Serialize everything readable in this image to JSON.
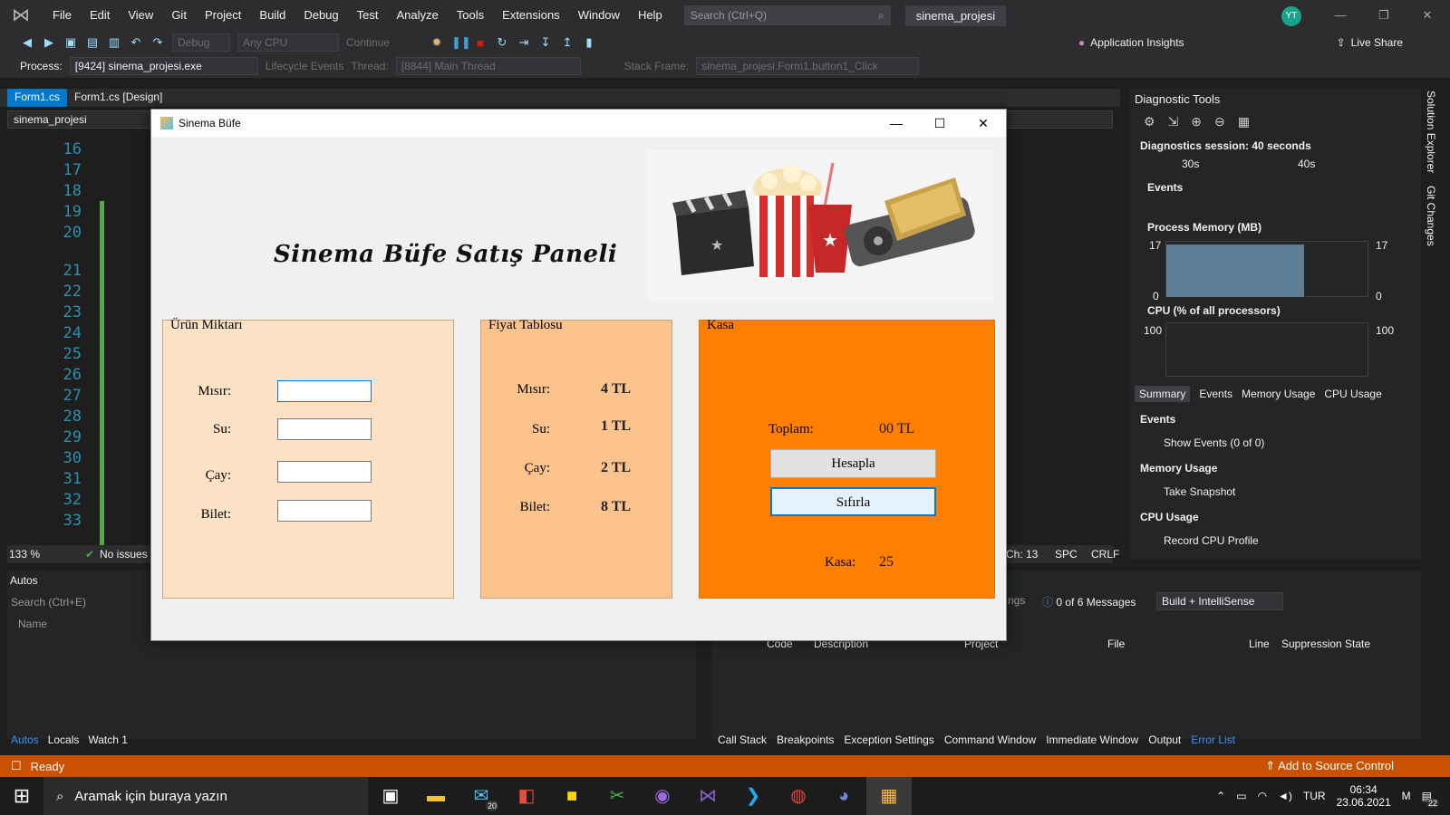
{
  "menu": [
    "File",
    "Edit",
    "View",
    "Git",
    "Project",
    "Build",
    "Debug",
    "Test",
    "Analyze",
    "Tools",
    "Extensions",
    "Window",
    "Help"
  ],
  "search": {
    "placeholder": "Search (Ctrl+Q)"
  },
  "solution_name": "sinema_projesi",
  "user_initials": "YT",
  "toolbar": {
    "config": "Debug",
    "platform": "Any CPU",
    "continue": "Continue",
    "app_insights": "Application Insights",
    "live_share": "Live Share"
  },
  "debug_bar": {
    "process_label": "Process:",
    "process": "[9424] sinema_projesi.exe",
    "lifecycle": "Lifecycle Events",
    "thread_label": "Thread:",
    "thread": "[8844] Main Thread",
    "stack_label": "Stack Frame:",
    "stack": "sinema_projesi.Form1.button1_Click"
  },
  "doc_tabs": [
    "Form1.cs",
    "Form1.cs [Design]"
  ],
  "nav_bar": "sinema_projesi",
  "editor": {
    "line_numbers": [
      "16",
      "17",
      "18",
      "19",
      "20",
      "21",
      "22",
      "23",
      "24",
      "25",
      "26",
      "27",
      "28",
      "29",
      "30",
      "31",
      "32",
      "33"
    ],
    "zoom": "133 %",
    "issues": "No issues f",
    "col": "Ch: 13",
    "spacing": "SPC",
    "eol": "CRLF"
  },
  "diagnostics": {
    "title": "Diagnostic Tools",
    "session": "Diagnostics session: 40 seconds",
    "timeline": [
      "30s",
      "40s"
    ],
    "events_header": "Events",
    "memory_header": "Process Memory (MB)",
    "memory_max": "17",
    "memory_min": "0",
    "cpu_header": "CPU (% of all processors)",
    "cpu_max": "100",
    "tabs": [
      "Summary",
      "Events",
      "Memory Usage",
      "CPU Usage"
    ],
    "sections": [
      {
        "title": "Events",
        "action": "Show Events (0 of 0)"
      },
      {
        "title": "Memory Usage",
        "action": "Take Snapshot"
      },
      {
        "title": "CPU Usage",
        "action": "Record CPU Profile"
      }
    ]
  },
  "side_tabs": [
    "Solution Explorer",
    "Git Changes"
  ],
  "autos": {
    "title": "Autos",
    "search": "Search (Ctrl+E)",
    "col": "Name",
    "tabs": [
      "Autos",
      "Locals",
      "Watch 1"
    ]
  },
  "errors": {
    "messages": "0 of 6 Messages",
    "build": "Build + IntelliSense",
    "partial": "ngs",
    "columns": [
      "Code",
      "Description",
      "Project",
      "File",
      "Line",
      "Suppression State"
    ],
    "tabs": [
      "Call Stack",
      "Breakpoints",
      "Exception Settings",
      "Command Window",
      "Immediate Window",
      "Output",
      "Error List"
    ]
  },
  "status": {
    "text": "Ready",
    "source_control": "Add to Source Control"
  },
  "taskbar": {
    "search": "Aramak için buraya yazın",
    "mail_badge": "20",
    "lang": "TUR",
    "time": "06:34",
    "date": "23.06.2021",
    "notif": "22"
  },
  "form": {
    "title": "Sinema Büfe",
    "heading": "Sinema  Büfe Satış Paneli",
    "group_quantity": {
      "title": "Ürün Miktarı",
      "labels": [
        "Mısır:",
        "Su:",
        "Çay:",
        "Bilet:"
      ]
    },
    "group_prices": {
      "title": "Fiyat Tablosu",
      "labels": [
        "Mısır:",
        "Su:",
        "Çay:",
        "Bilet:"
      ],
      "prices": [
        "4 TL",
        "1 TL",
        "2 TL",
        "8 TL"
      ]
    },
    "group_kasa": {
      "title": "Kasa",
      "total_label": "Toplam:",
      "total_value": "00 TL",
      "calc_button": "Hesapla",
      "reset_button": "Sıfırla",
      "kasa_label": "Kasa:",
      "kasa_value": "25"
    },
    "colors": {
      "quantity_bg": "#fde2c6",
      "prices_bg": "#fcc38d",
      "kasa_bg": "#ff8000"
    }
  }
}
